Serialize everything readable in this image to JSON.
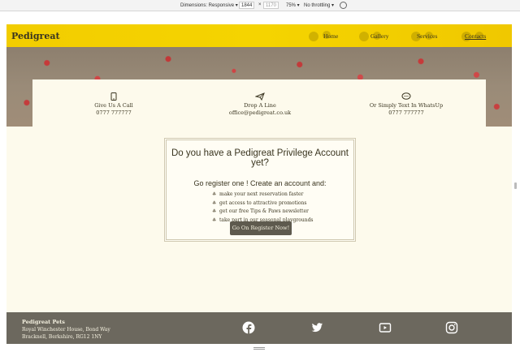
{
  "devtools": {
    "dimensions_label": "Dimensions: Responsive",
    "width": "1844",
    "height": "1170",
    "zoom": "75%",
    "throttling": "No throttling"
  },
  "navbar": {
    "brand": "Pedigreat",
    "links": [
      "Home",
      "Gallery",
      "Services",
      "Contacts"
    ],
    "active": "Contacts"
  },
  "contacts": [
    {
      "icon": "phone-icon",
      "title": "Give Us A Call",
      "detail": "0777 777777"
    },
    {
      "icon": "paper-plane-icon",
      "title": "Drop A Line",
      "detail": "office@pedigreat.co.uk"
    },
    {
      "icon": "chat-icon",
      "title": "Or Simply Text In WhatsUp",
      "detail": "0777 777777"
    }
  ],
  "privilege": {
    "heading": "Do you have a Pedigreat Privilege Account yet?",
    "subheading": "Go register one ! Create an account and:",
    "benefits": [
      "make your next reservation faster",
      "get access to attractive promotions",
      "get our free Tips & Paws newsletter",
      "take part in our seasonal playgrounds"
    ],
    "button": "Go On Register Now!"
  },
  "footer": {
    "name": "Pedigreat Pets",
    "address_line1": "Royal Winchester House, Bond Way",
    "address_line2": "Bracknell, Berkshire, RG12 1NY",
    "social": [
      "facebook-icon",
      "twitter-icon",
      "youtube-icon",
      "instagram-icon"
    ]
  }
}
